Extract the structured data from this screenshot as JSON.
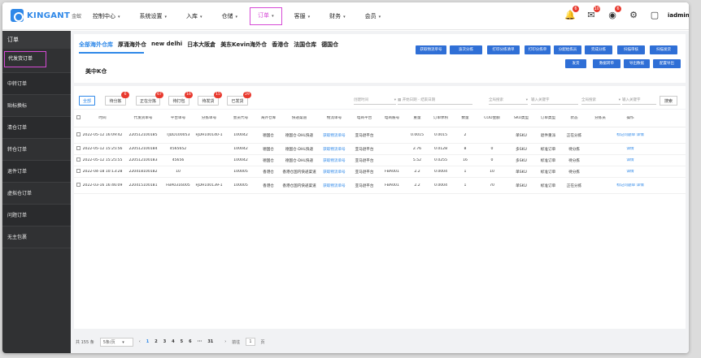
{
  "brand": {
    "logo_text": "KINGANT",
    "logo_sub": "金蚁"
  },
  "nav": {
    "items": [
      {
        "label": "控制中心"
      },
      {
        "label": "系统设置"
      },
      {
        "label": "入库"
      },
      {
        "label": "仓储"
      },
      {
        "label": "订单"
      },
      {
        "label": "客服"
      },
      {
        "label": "财务"
      },
      {
        "label": "会员"
      }
    ],
    "active_index": 4,
    "dropdown_glyph": "▾"
  },
  "toolbar": {
    "icons": [
      {
        "name": "bell-icon",
        "glyph": "🔔",
        "badge": "6"
      },
      {
        "name": "message-icon",
        "glyph": "✉",
        "badge": "10"
      },
      {
        "name": "notice-icon",
        "glyph": "◉",
        "badge": "6"
      },
      {
        "name": "settings-icon",
        "glyph": "⚙",
        "badge": ""
      },
      {
        "name": "chat-icon",
        "glyph": "▢",
        "badge": ""
      }
    ],
    "user": "iadmin"
  },
  "sidebar": {
    "title": "订单",
    "items": [
      "代发货订单",
      "中转订单",
      "贴标换标",
      "清仓订单",
      "转仓订单",
      "退件订单",
      "虚拟仓订单",
      "问题订单",
      "无主包裹"
    ],
    "active_index": 0
  },
  "warehouse_tabs": [
    "全部海外仓库",
    "厚涌海外仓",
    "new delhi",
    "日本大阪倉",
    "美东Kevin海外仓",
    "香港仓",
    "法国仓库",
    "德国仓"
  ],
  "warehouse_tab_row2": "美中K仓",
  "action_buttons_row1": [
    "获取物流单号",
    "波次分拣",
    "打印分拣清单",
    "打印分拣单",
    "分配给拣员",
    "完成分拣",
    "扫描审核",
    "扫描发货"
  ],
  "action_buttons_row2": [
    "发货",
    "数据转单",
    "导出数据",
    "配置导出"
  ],
  "status_filters": [
    {
      "label": "全部",
      "badge": ""
    },
    {
      "label": "待分拣",
      "badge": "6"
    },
    {
      "label": "正在分拣",
      "badge": "67"
    },
    {
      "label": "待打包",
      "badge": "16"
    },
    {
      "label": "待发货",
      "badge": "15"
    },
    {
      "label": "已发货",
      "badge": "29"
    }
  ],
  "filters": {
    "time_type": "创建时间",
    "start_placeholder": "开始日期",
    "range_sep": "-",
    "end_placeholder": "结束日期",
    "search_type_1": "全局搜索",
    "keyword_placeholder_1": "输入关键字",
    "search_type_2": "全局搜索",
    "keyword_placeholder_2": "输入关键字",
    "search_label": "搜索"
  },
  "table": {
    "headers": [
      "时间",
      "代发货单号",
      "平台单号",
      "分拣单号",
      "会员代号",
      "海外仓库",
      "快递渠道",
      "物流单号",
      "电商平台",
      "电商账号",
      "重量",
      "订单体积",
      "数量",
      "COD金额",
      "SKU类型",
      "订单类型",
      "状态",
      "分拣员",
      "操作"
    ],
    "rows": [
      [
        "2022-05-12 16:09:42",
        "220512100185",
        "TJDD100053",
        "FJDH100140-1",
        "100042",
        "德国仓",
        "德国仓-DHL快递",
        "获取物流单号",
        "亚马逊平台",
        "",
        "0.0015",
        "0.0015",
        "2",
        "",
        "单SKU",
        "退件重派",
        "正在分拣",
        "",
        "标记问题单 详情"
      ],
      [
        "2022-05-12 15:25:56",
        "220512100184",
        "4565652",
        "",
        "100042",
        "德国仓",
        "德国仓-DHL快递",
        "获取物流单号",
        "亚马逊平台",
        "",
        "2.76",
        "0.0128",
        "8",
        "0",
        "多SKU",
        "标准订单",
        "待分拣",
        "",
        "详情"
      ],
      [
        "2022-05-12 15:25:55",
        "220512100183",
        "45656",
        "",
        "100042",
        "德国仓",
        "德国仓-DHL快递",
        "获取物流单号",
        "亚马逊平台",
        "",
        "5.52",
        "0.0255",
        "16",
        "0",
        "多SKU",
        "标准订单",
        "待分拣",
        "",
        "详情"
      ],
      [
        "2022-04-18 10:13:28",
        "220418100182",
        "10",
        "",
        "100005",
        "香港仓",
        "香港仓国内快递渠道",
        "获取物流单号",
        "亚马逊平台",
        "FBA001",
        "2.2",
        "0.0004",
        "1",
        "10",
        "单SKU",
        "标准订单",
        "待分拣",
        "",
        "详情"
      ],
      [
        "2022-03-16 16:46:09",
        "220415100181",
        "FBA0316005",
        "FJDH100139-1",
        "100005",
        "香港仓",
        "香港仓国内快递渠道",
        "获取物流单号",
        "亚马逊平台",
        "FBA001",
        "2.2",
        "0.0004",
        "1",
        "70",
        "单SKU",
        "标准订单",
        "正在分拣",
        "",
        "标记问题单 详情"
      ]
    ]
  },
  "pager": {
    "total": "共 155 条",
    "page_size": "5条/页",
    "prev": "‹",
    "pages": [
      "1",
      "2",
      "3",
      "4",
      "5",
      "6",
      "···",
      "31"
    ],
    "next": "›",
    "goto_label": "前往",
    "goto_value": "1",
    "goto_suffix": "页"
  }
}
